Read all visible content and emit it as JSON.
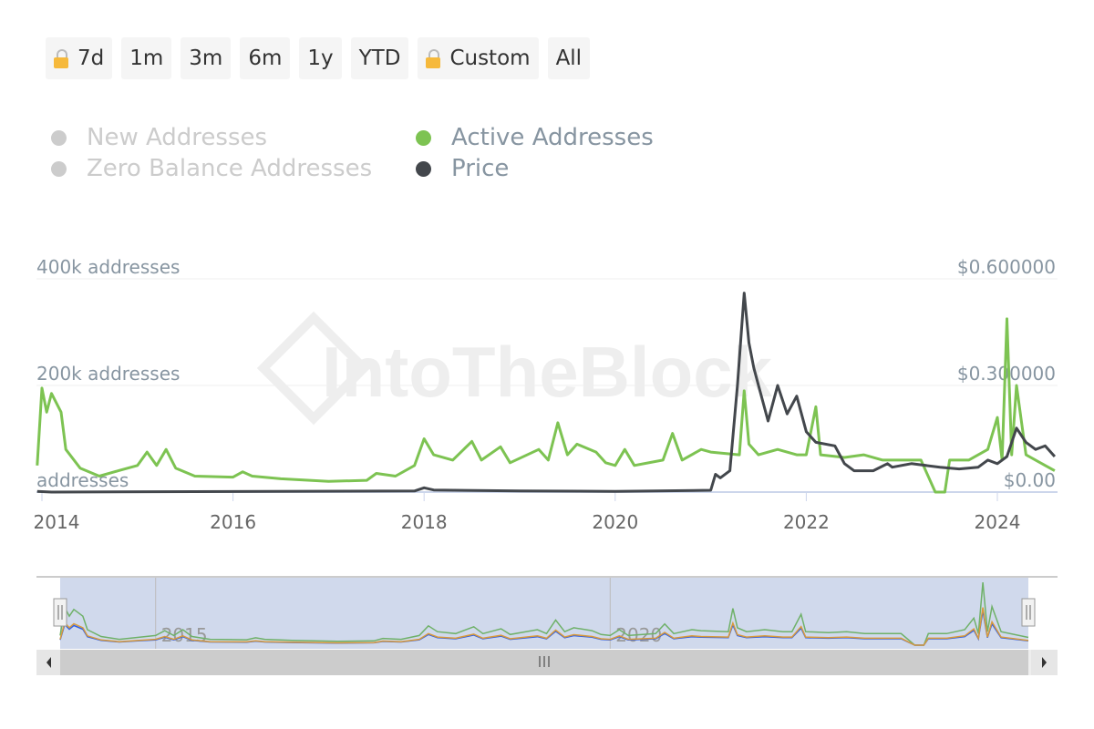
{
  "range_buttons": [
    {
      "label": "7d",
      "locked": true
    },
    {
      "label": "1m"
    },
    {
      "label": "3m"
    },
    {
      "label": "6m"
    },
    {
      "label": "1y"
    },
    {
      "label": "YTD"
    },
    {
      "label": "Custom",
      "locked": true
    },
    {
      "label": "All"
    }
  ],
  "legend": [
    {
      "name": "New Addresses",
      "color": "#cccccc",
      "active": false
    },
    {
      "name": "Zero Balance Addresses",
      "color": "#cccccc",
      "active": false
    },
    {
      "name": "Active Addresses",
      "color": "#7dc352",
      "active": true
    },
    {
      "name": "Price",
      "color": "#43474c",
      "active": true
    }
  ],
  "watermark": "IntoTheBlock",
  "chart_data": {
    "type": "line",
    "x_ticks": [
      "2014",
      "2016",
      "2018",
      "2020",
      "2022",
      "2024"
    ],
    "y_left": {
      "ticks": [
        "addresses",
        "200k addresses",
        "400k addresses"
      ],
      "range": [
        0,
        400000
      ]
    },
    "y_right": {
      "ticks": [
        "$0.00",
        "$0.300000",
        "$0.600000"
      ],
      "range": [
        0,
        0.6
      ]
    },
    "grid": true,
    "legend_placement": "top-left",
    "series": [
      {
        "name": "Active Addresses",
        "axis": "left",
        "color": "#7dc352",
        "points": [
          [
            2013.95,
            50000
          ],
          [
            2014.0,
            195000
          ],
          [
            2014.05,
            150000
          ],
          [
            2014.1,
            185000
          ],
          [
            2014.2,
            150000
          ],
          [
            2014.25,
            80000
          ],
          [
            2014.4,
            45000
          ],
          [
            2014.6,
            30000
          ],
          [
            2014.8,
            40000
          ],
          [
            2015.0,
            50000
          ],
          [
            2015.1,
            75000
          ],
          [
            2015.2,
            50000
          ],
          [
            2015.3,
            80000
          ],
          [
            2015.4,
            45000
          ],
          [
            2015.6,
            30000
          ],
          [
            2016.0,
            28000
          ],
          [
            2016.1,
            38000
          ],
          [
            2016.2,
            30000
          ],
          [
            2016.5,
            25000
          ],
          [
            2017.0,
            20000
          ],
          [
            2017.4,
            22000
          ],
          [
            2017.5,
            35000
          ],
          [
            2017.7,
            30000
          ],
          [
            2017.9,
            50000
          ],
          [
            2018.0,
            100000
          ],
          [
            2018.1,
            70000
          ],
          [
            2018.3,
            60000
          ],
          [
            2018.5,
            95000
          ],
          [
            2018.6,
            60000
          ],
          [
            2018.8,
            85000
          ],
          [
            2018.9,
            55000
          ],
          [
            2019.2,
            80000
          ],
          [
            2019.3,
            60000
          ],
          [
            2019.4,
            130000
          ],
          [
            2019.5,
            70000
          ],
          [
            2019.6,
            90000
          ],
          [
            2019.8,
            75000
          ],
          [
            2019.9,
            55000
          ],
          [
            2020.0,
            50000
          ],
          [
            2020.1,
            80000
          ],
          [
            2020.2,
            50000
          ],
          [
            2020.5,
            60000
          ],
          [
            2020.6,
            110000
          ],
          [
            2020.7,
            60000
          ],
          [
            2020.9,
            80000
          ],
          [
            2021.0,
            75000
          ],
          [
            2021.3,
            70000
          ],
          [
            2021.35,
            190000
          ],
          [
            2021.4,
            90000
          ],
          [
            2021.5,
            70000
          ],
          [
            2021.7,
            80000
          ],
          [
            2021.9,
            70000
          ],
          [
            2022.0,
            70000
          ],
          [
            2022.1,
            160000
          ],
          [
            2022.15,
            70000
          ],
          [
            2022.4,
            65000
          ],
          [
            2022.6,
            70000
          ],
          [
            2022.8,
            60000
          ],
          [
            2023.0,
            60000
          ],
          [
            2023.2,
            60000
          ],
          [
            2023.35,
            0
          ],
          [
            2023.45,
            0
          ],
          [
            2023.5,
            60000
          ],
          [
            2023.7,
            60000
          ],
          [
            2023.9,
            80000
          ],
          [
            2024.0,
            140000
          ],
          [
            2024.05,
            60000
          ],
          [
            2024.1,
            325000
          ],
          [
            2024.15,
            70000
          ],
          [
            2024.2,
            200000
          ],
          [
            2024.3,
            70000
          ],
          [
            2024.6,
            40000
          ]
        ]
      },
      {
        "name": "Price",
        "axis": "right",
        "color": "#43474c",
        "points": [
          [
            2013.95,
            0.002
          ],
          [
            2014.1,
            0
          ],
          [
            2017.9,
            0.003
          ],
          [
            2018.0,
            0.012
          ],
          [
            2018.1,
            0.006
          ],
          [
            2019.0,
            0.003
          ],
          [
            2020.0,
            0.002
          ],
          [
            2021.0,
            0.005
          ],
          [
            2021.05,
            0.05
          ],
          [
            2021.1,
            0.04
          ],
          [
            2021.2,
            0.06
          ],
          [
            2021.28,
            0.3
          ],
          [
            2021.35,
            0.56
          ],
          [
            2021.4,
            0.42
          ],
          [
            2021.45,
            0.35
          ],
          [
            2021.5,
            0.3
          ],
          [
            2021.6,
            0.2
          ],
          [
            2021.7,
            0.3
          ],
          [
            2021.8,
            0.22
          ],
          [
            2021.9,
            0.27
          ],
          [
            2022.0,
            0.17
          ],
          [
            2022.1,
            0.14
          ],
          [
            2022.3,
            0.13
          ],
          [
            2022.4,
            0.08
          ],
          [
            2022.5,
            0.06
          ],
          [
            2022.7,
            0.06
          ],
          [
            2022.85,
            0.08
          ],
          [
            2022.9,
            0.07
          ],
          [
            2023.1,
            0.08
          ],
          [
            2023.4,
            0.07
          ],
          [
            2023.6,
            0.065
          ],
          [
            2023.8,
            0.07
          ],
          [
            2023.9,
            0.09
          ],
          [
            2024.0,
            0.08
          ],
          [
            2024.1,
            0.1
          ],
          [
            2024.2,
            0.18
          ],
          [
            2024.3,
            0.14
          ],
          [
            2024.4,
            0.12
          ],
          [
            2024.5,
            0.13
          ],
          [
            2024.6,
            0.1
          ]
        ]
      }
    ],
    "navigator": {
      "x_ticks": [
        "2015",
        "2020"
      ]
    }
  }
}
